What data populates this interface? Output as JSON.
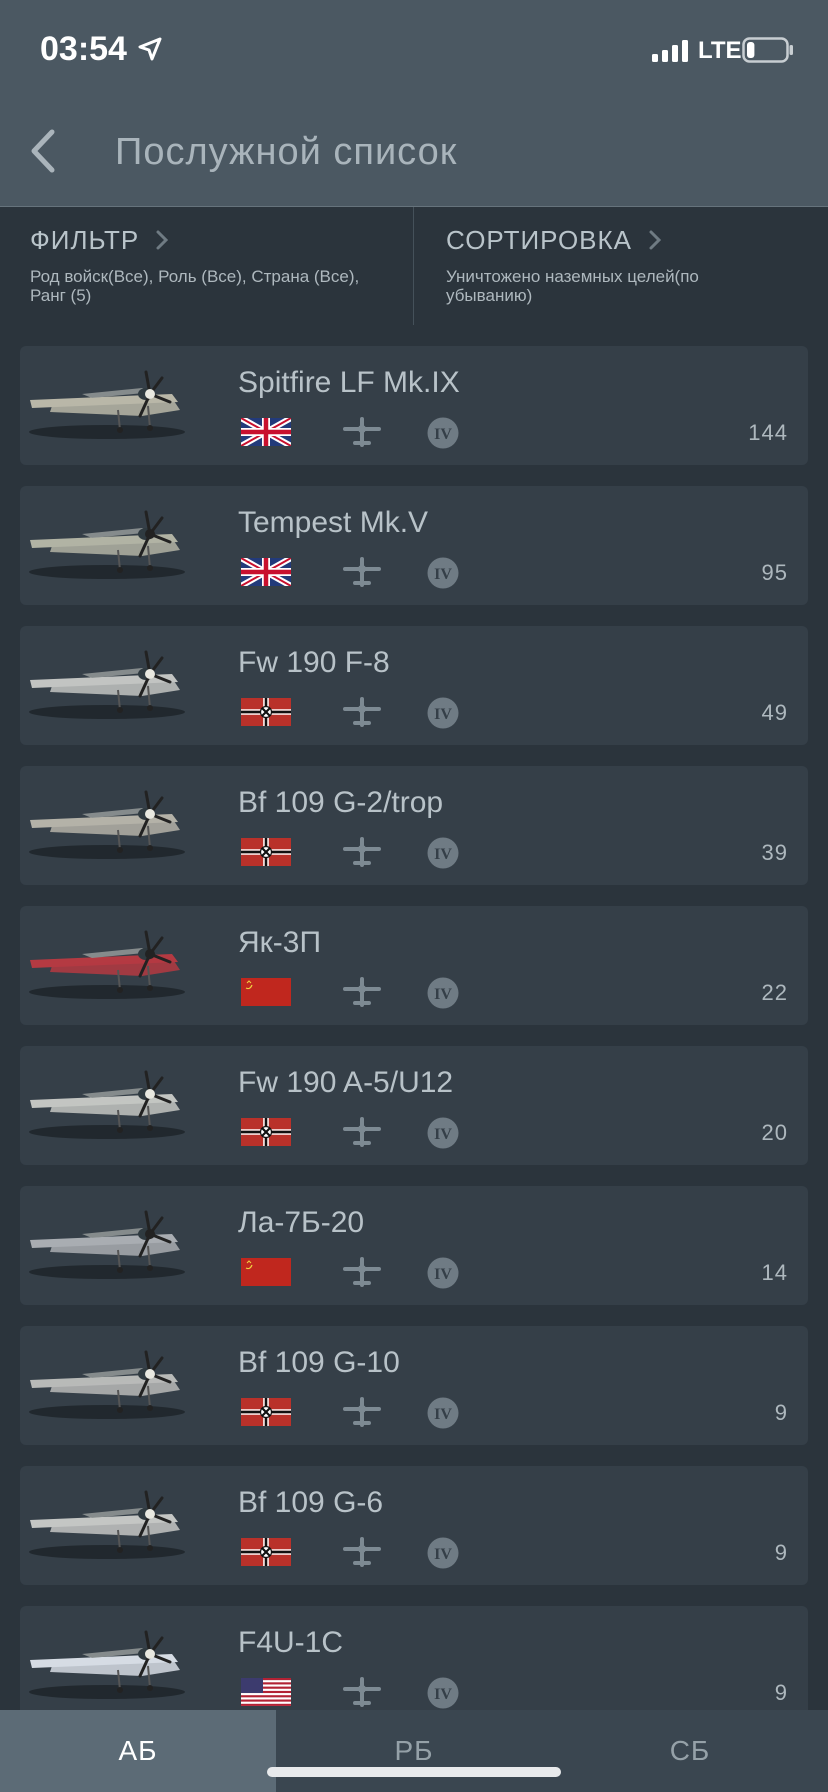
{
  "status": {
    "time": "03:54",
    "network": "LTE",
    "battery_level": 0.2
  },
  "header": {
    "title": "Послужной список"
  },
  "filter": {
    "title": "ФИЛЬТР",
    "value": "Род войск(Все), Роль (Все), Страна (Все), Ранг (5)"
  },
  "sort": {
    "title": "СОРТИРОВКА",
    "value": "Уничтожено наземных целей(по убыванию)"
  },
  "vehicles": [
    {
      "name": "Spitfire LF Mk.IX",
      "country": "uk",
      "rank": "IV",
      "count": "144"
    },
    {
      "name": "Tempest Mk.V",
      "country": "uk",
      "rank": "IV",
      "count": "95"
    },
    {
      "name": "Fw 190 F-8",
      "country": "germany",
      "rank": "IV",
      "count": "49"
    },
    {
      "name": "Bf 109 G-2/trop",
      "country": "germany",
      "rank": "IV",
      "count": "39"
    },
    {
      "name": "Як-3П",
      "country": "ussr",
      "rank": "IV",
      "count": "22"
    },
    {
      "name": "Fw 190 A-5/U12",
      "country": "germany",
      "rank": "IV",
      "count": "20"
    },
    {
      "name": "Ла-7Б-20",
      "country": "ussr",
      "rank": "IV",
      "count": "14"
    },
    {
      "name": "Bf 109 G-10",
      "country": "germany",
      "rank": "IV",
      "count": "9"
    },
    {
      "name": "Bf 109 G-6",
      "country": "germany",
      "rank": "IV",
      "count": "9"
    },
    {
      "name": "F4U-1C",
      "country": "usa",
      "rank": "IV",
      "count": "9"
    }
  ],
  "tabs": [
    {
      "label": "АБ",
      "active": true
    },
    {
      "label": "РБ",
      "active": false
    },
    {
      "label": "СБ",
      "active": false
    }
  ],
  "colors": {
    "header_bg": "#4b5862",
    "page_bg": "#2b343c",
    "card_bg": "#353f48",
    "active_tab": "#5c6b76"
  }
}
